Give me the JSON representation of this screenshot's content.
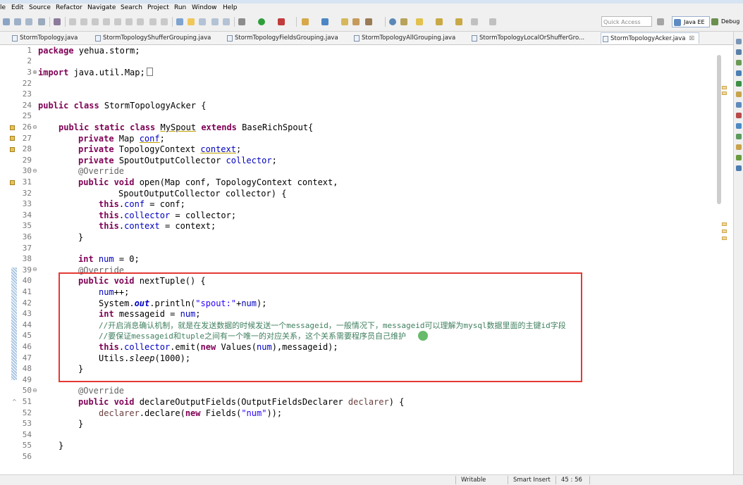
{
  "menu": [
    "le",
    "Edit",
    "Source",
    "Refactor",
    "Navigate",
    "Search",
    "Project",
    "Run",
    "Window",
    "Help"
  ],
  "toolbar": {
    "quick_access_placeholder": "Quick Access",
    "perspectives": [
      "Java EE",
      "Debug"
    ]
  },
  "tabs": [
    {
      "label": "StormTopology.java",
      "active": false
    },
    {
      "label": "StormTopologyShufferGrouping.java",
      "active": false
    },
    {
      "label": "StormTopologyFieldsGrouping.java",
      "active": false
    },
    {
      "label": "StormTopologyAllGrouping.java",
      "active": false
    },
    {
      "label": "StormTopologyLocalOrShufferGro...",
      "active": false
    },
    {
      "label": "StormTopologyAcker.java",
      "active": true,
      "close": "☒"
    }
  ],
  "line_numbers": [
    "1",
    "2",
    "3",
    "22",
    "23",
    "24",
    "25",
    "26",
    "27",
    "28",
    "29",
    "30",
    "31",
    "32",
    "33",
    "34",
    "35",
    "36",
    "37",
    "38",
    "39",
    "40",
    "41",
    "42",
    "43",
    "44",
    "45",
    "46",
    "47",
    "48",
    "49",
    "50",
    "51",
    "52",
    "53",
    "54",
    "55",
    "56"
  ],
  "code": {
    "l1_kw": "package",
    "l1_rest": " yehua.storm;",
    "l3_kw": "import",
    "l3_rest": " java.util.Map;",
    "l24_kw": "public class",
    "l24_rest": " StormTopologyAcker {",
    "l26_a": "public static class",
    "l26_b": "MySpout",
    "l26_c": "extends",
    "l26_d": " BaseRichSpout{",
    "l27_a": "private",
    "l27_b": " Map ",
    "l27_c": "conf",
    "l27_d": ";",
    "l28_a": "private",
    "l28_b": " TopologyContext ",
    "l28_c": "context",
    "l28_d": ";",
    "l29_a": "private",
    "l29_b": " SpoutOutputCollector ",
    "l29_c": "collector",
    "l29_d": ";",
    "l30": "@Override",
    "l31_a": "public void",
    "l31_b": " open(Map conf, TopologyContext context,",
    "l32": "SpoutOutputCollector collector) {",
    "l33_a": "this",
    "l33_b": ".",
    "l33_c": "conf",
    "l33_d": " = conf;",
    "l34_a": "this",
    "l34_b": ".",
    "l34_c": "collector",
    "l34_d": " = collector;",
    "l35_a": "this",
    "l35_b": ".",
    "l35_c": "context",
    "l35_d": " = context;",
    "l36": "}",
    "l38_a": "int",
    "l38_b": " num",
    "l38_c": " = 0;",
    "l39": "@Override",
    "l40_a": "public void",
    "l40_b": " nextTuple() {",
    "l41_a": "num",
    "l41_b": "++;",
    "l42_a": "System.",
    "l42_b": "out",
    "l42_c": ".println(",
    "l42_d": "\"spout:\"",
    "l42_e": "+",
    "l42_f": "num",
    "l42_g": ");",
    "l43_a": "int",
    "l43_b": " messageid = ",
    "l43_c": "num",
    "l43_d": ";",
    "l44": "//开启消息确认机制，就是在发送数据的时候发送一个messageid，一般情况下，messageid可以理解为mysql数据里面的主键id字段",
    "l45": "//要保证messageid和tuple之间有一个唯一的对应关系，这个关系需要程序员自己维护",
    "l46_a": "this",
    "l46_b": ".",
    "l46_c": "collector",
    "l46_d": ".emit(",
    "l46_e": "new",
    "l46_f": " Values(",
    "l46_g": "num",
    "l46_h": "),messageid);",
    "l47_a": "Utils.",
    "l47_b": "sleep",
    "l47_c": "(1000);",
    "l48": "}",
    "l50": "@Override",
    "l51_a": "public void",
    "l51_b": " declareOutputFields(OutputFieldsDeclarer ",
    "l51_c": "declarer",
    "l51_d": ") {",
    "l52_a": "declarer",
    "l52_b": ".declare(",
    "l52_c": "new",
    "l52_d": " Fields(",
    "l52_e": "\"num\"",
    "l52_f": "));",
    "l53": "}",
    "l55": "}"
  },
  "status": {
    "writable": "Writable",
    "insert_mode": "Smart Insert",
    "position": "45 : 56"
  },
  "colors": {
    "keyword": "#7f0055",
    "field": "#0000c0",
    "string": "#2a00ff",
    "comment": "#3f7f5f",
    "annotation": "#646464",
    "highlight_box": "#e53935"
  }
}
